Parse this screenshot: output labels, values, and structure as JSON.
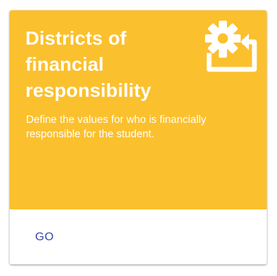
{
  "card": {
    "title": "Districts of financial responsibility",
    "description": "Define the values for who is financially responsible for the student.",
    "icon": "settings-gear-return-icon",
    "accent_color": "#fbc02d",
    "action_label": "GO",
    "action_color": "#3949ab"
  }
}
